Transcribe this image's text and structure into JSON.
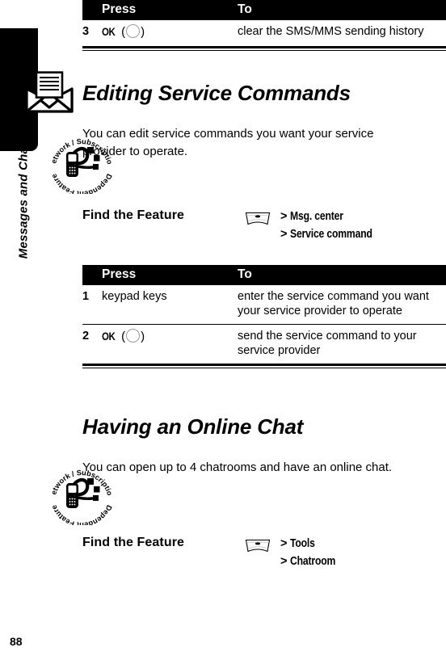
{
  "chapter": {
    "label": "Messages and Chat",
    "icon": "envelope-icon"
  },
  "page_number": "88",
  "table_top": {
    "headers": {
      "num": "",
      "press": "Press",
      "to": "To"
    },
    "rows": [
      {
        "num": "3",
        "press_text": "OK",
        "press_key": "softkey-circle",
        "to": "clear the SMS/MMS sending history"
      }
    ]
  },
  "sections": [
    {
      "heading": "Editing Service Commands",
      "badge": {
        "top_arc": "Network / Subscription",
        "bottom_arc": "Dependent Feature",
        "icon": "network-subscription-badge-icon"
      },
      "body": "You can edit service commands you want your service provider to operate.",
      "find_the_feature": {
        "label": "Find the Feature",
        "menu_key_icon": "menu-key-icon",
        "path": [
          "Msg. center",
          "Service command"
        ]
      },
      "table": {
        "headers": {
          "num": "",
          "press": "Press",
          "to": "To"
        },
        "rows": [
          {
            "num": "1",
            "press_text": "keypad keys",
            "press_key": "",
            "to": "enter the service command you want your service provider to operate"
          },
          {
            "num": "2",
            "press_text": "OK",
            "press_key": "softkey-circle",
            "to": "send the service command to your service provider"
          }
        ]
      }
    },
    {
      "heading": "Having an Online Chat",
      "badge": {
        "top_arc": "Network / Subscription",
        "bottom_arc": "Dependent Feature",
        "icon": "network-subscription-badge-icon"
      },
      "body": "You can open up to 4 chatrooms and have an online chat.",
      "find_the_feature": {
        "label": "Find the Feature",
        "menu_key_icon": "menu-key-icon",
        "path": [
          "Tools",
          "Chatroom"
        ]
      }
    }
  ],
  "colors": {
    "header_bg": "#000000",
    "header_fg": "#ffffff",
    "text": "#000000",
    "page_bg": "#ffffff",
    "key_outline": "#9a9a9a"
  }
}
